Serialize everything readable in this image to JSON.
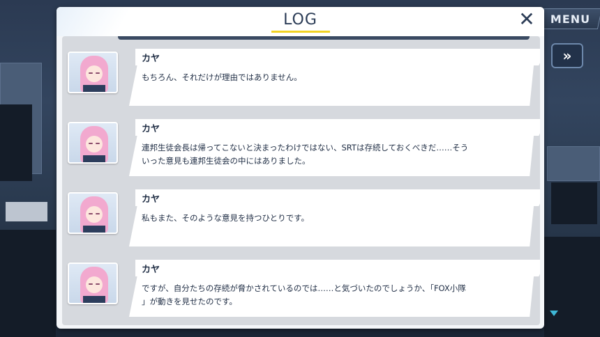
{
  "panel": {
    "title": "LOG"
  },
  "controls": {
    "menu_label": "MENU",
    "fast_forward_label": "»"
  },
  "entries": [
    {
      "speaker": "カヤ",
      "line1": "もちろん、それだけが理由ではありません。",
      "line2": ""
    },
    {
      "speaker": "カヤ",
      "line1": "連邦生徒会長は帰ってこないと決まったわけではない、SRTは存続しておくべきだ……そう",
      "line2": "いった意見も連邦生徒会の中にはありました。"
    },
    {
      "speaker": "カヤ",
      "line1": "私もまた、そのような意見を持つひとりです。",
      "line2": ""
    },
    {
      "speaker": "カヤ",
      "line1": "ですが、自分たちの存続が脅かされているのでは……と気づいたのでしょうか、「FOX小隊",
      "line2": "」が動きを見せたのです。"
    }
  ],
  "colors": {
    "accent_underline": "#f2d324",
    "hair": "#f2a9cf",
    "text": "#1f2d44"
  },
  "icons": {
    "close": "close-icon",
    "fast_forward": "fast-forward-icon",
    "scroll_down": "scroll-down-icon",
    "avatar": "character-avatar"
  }
}
